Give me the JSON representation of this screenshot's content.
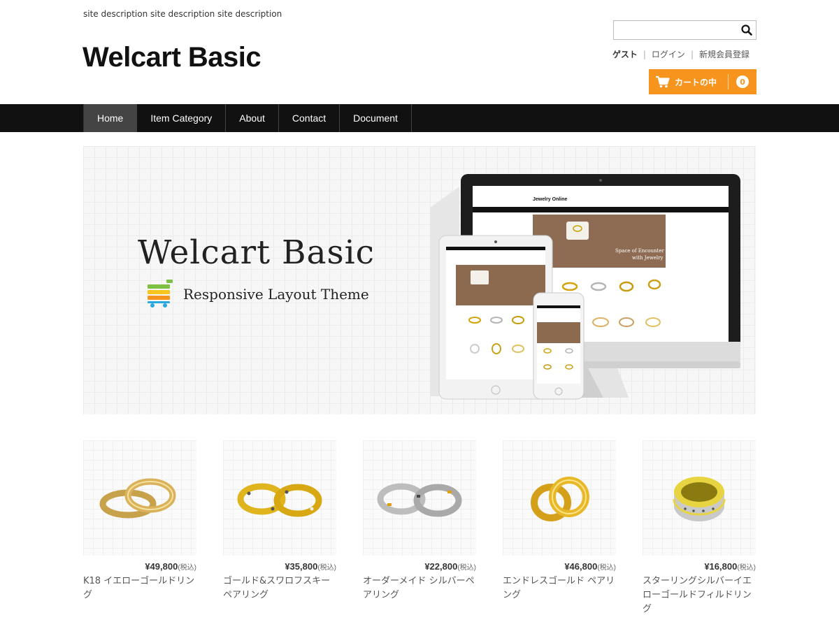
{
  "header": {
    "site_description": "site description site description site description",
    "site_title": "Welcart Basic",
    "search_placeholder": "",
    "member": {
      "guest": "ゲスト",
      "login": "ログイン",
      "register": "新規会員登録"
    },
    "cart": {
      "label": "カートの中",
      "count": "0",
      "color": "#f7941d"
    }
  },
  "nav": {
    "items": [
      {
        "label": "Home",
        "active": true
      },
      {
        "label": "Item Category"
      },
      {
        "label": "About"
      },
      {
        "label": "Contact"
      },
      {
        "label": "Document"
      }
    ]
  },
  "hero": {
    "title": "Welcart Basic",
    "subtitle": "Responsive Layout Theme",
    "screen_site_title": "Jewelry Online",
    "screen_tagline_1": "Space of Encounter",
    "screen_tagline_2": "with Jewelry"
  },
  "products": [
    {
      "price": "¥49,800",
      "tax": "(税込)",
      "name": "K18 イエローゴールドリング",
      "ring": "gold-plain"
    },
    {
      "price": "¥35,800",
      "tax": "(税込)",
      "name": "ゴールド&スワロフスキーペアリング",
      "ring": "gold-stones"
    },
    {
      "price": "¥22,800",
      "tax": "(税込)",
      "name": "オーダーメイド シルバーペアリング",
      "ring": "silver-pair"
    },
    {
      "price": "¥46,800",
      "tax": "(税込)",
      "name": "エンドレスゴールド ペアリング",
      "ring": "gold-endless"
    },
    {
      "price": "¥16,800",
      "tax": "(税込)",
      "name": "スターリングシルバーイエローゴールドフィルドリング",
      "ring": "silver-gold-band"
    }
  ]
}
